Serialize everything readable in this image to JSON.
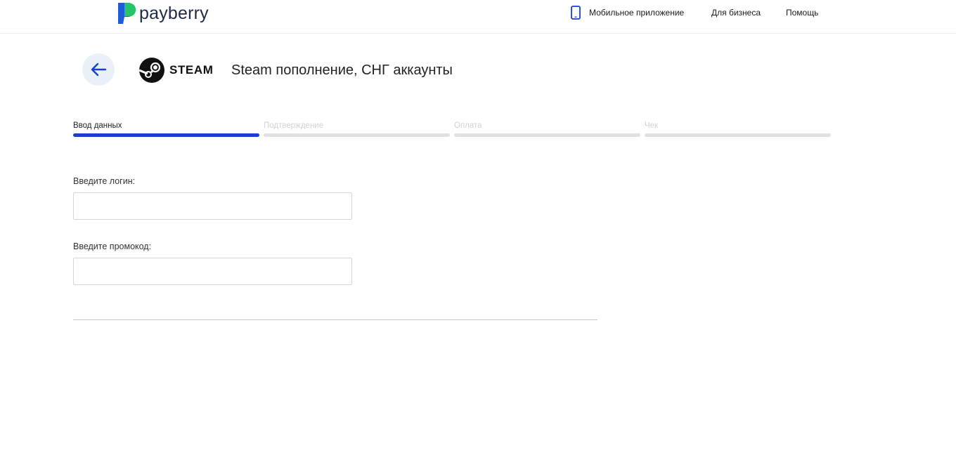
{
  "header": {
    "brand": "payberry",
    "nav": {
      "mobile_app": "Мобильное приложение",
      "business": "Для бизнеса",
      "help": "Помощь"
    }
  },
  "service": {
    "logo_word": "STEAM",
    "title": "Steam пополнение, СНГ аккаунты"
  },
  "steps": [
    {
      "label": "Ввод данных",
      "active": true
    },
    {
      "label": "Подтверждение",
      "active": false
    },
    {
      "label": "Оплата",
      "active": false
    },
    {
      "label": "Чек",
      "active": false
    }
  ],
  "form": {
    "login_label": "Введите логин:",
    "login_value": "",
    "promo_label": "Введите промокод:",
    "promo_value": ""
  },
  "colors": {
    "accent": "#1a3fc9",
    "brand_blue": "#1e5bd8",
    "brand_green": "#27c36a",
    "back_button_bg": "#eaf0f8"
  },
  "icons": {
    "back": "arrow-left-icon",
    "mobile": "smartphone-icon",
    "steam": "steam-logo-icon"
  }
}
